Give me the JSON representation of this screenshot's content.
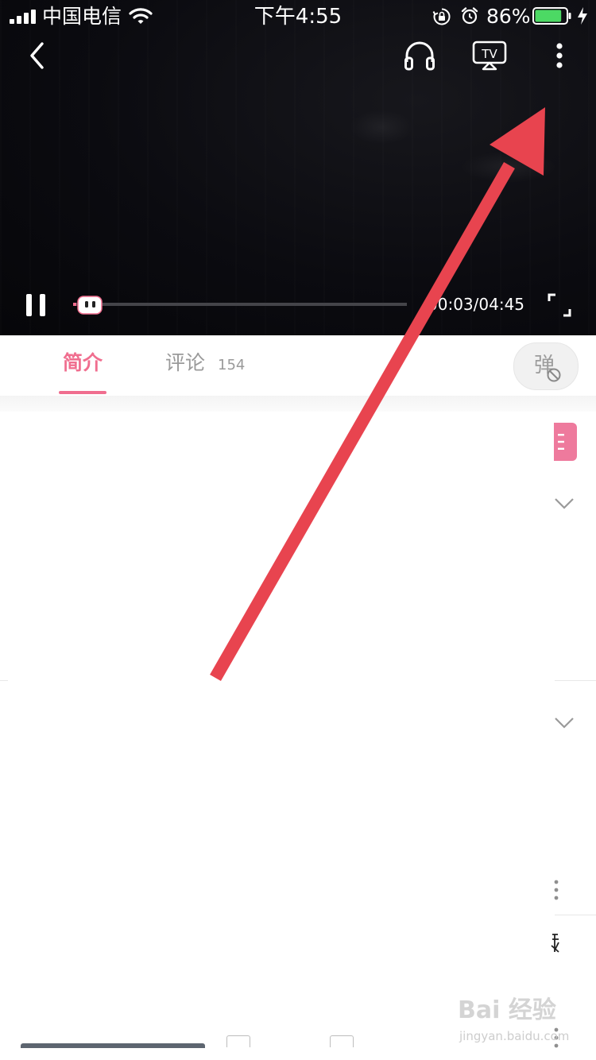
{
  "status_bar": {
    "carrier": "中国电信",
    "time": "下午4:55",
    "battery_percent": "86%",
    "battery_level": 0.86,
    "icons": [
      "signal-icon",
      "wifi-icon",
      "rotation-lock-icon",
      "alarm-icon",
      "battery-icon",
      "charging-icon"
    ]
  },
  "player": {
    "top_icons": [
      "back-icon",
      "headphone-icon",
      "tv-cast-icon",
      "more-icon"
    ],
    "tv_label": "TV",
    "time_readout": "00:03/04:45",
    "progress_fraction": 0.0105,
    "bottom_icons": [
      "pause-icon",
      "progress-thumb-icon",
      "fullscreen-icon"
    ]
  },
  "tabs": {
    "intro_label": "简介",
    "comments_label": "评论",
    "comments_count": "154",
    "danmaku_label": "弹"
  },
  "colors": {
    "accent": "#f06e8f",
    "arrow": "#e8444f",
    "video_bg": "#0b0b10",
    "tab_inactive": "#9a9a9a"
  },
  "watermark": {
    "logo": "Bai 经验",
    "url": "jingyan.baidu.com"
  }
}
